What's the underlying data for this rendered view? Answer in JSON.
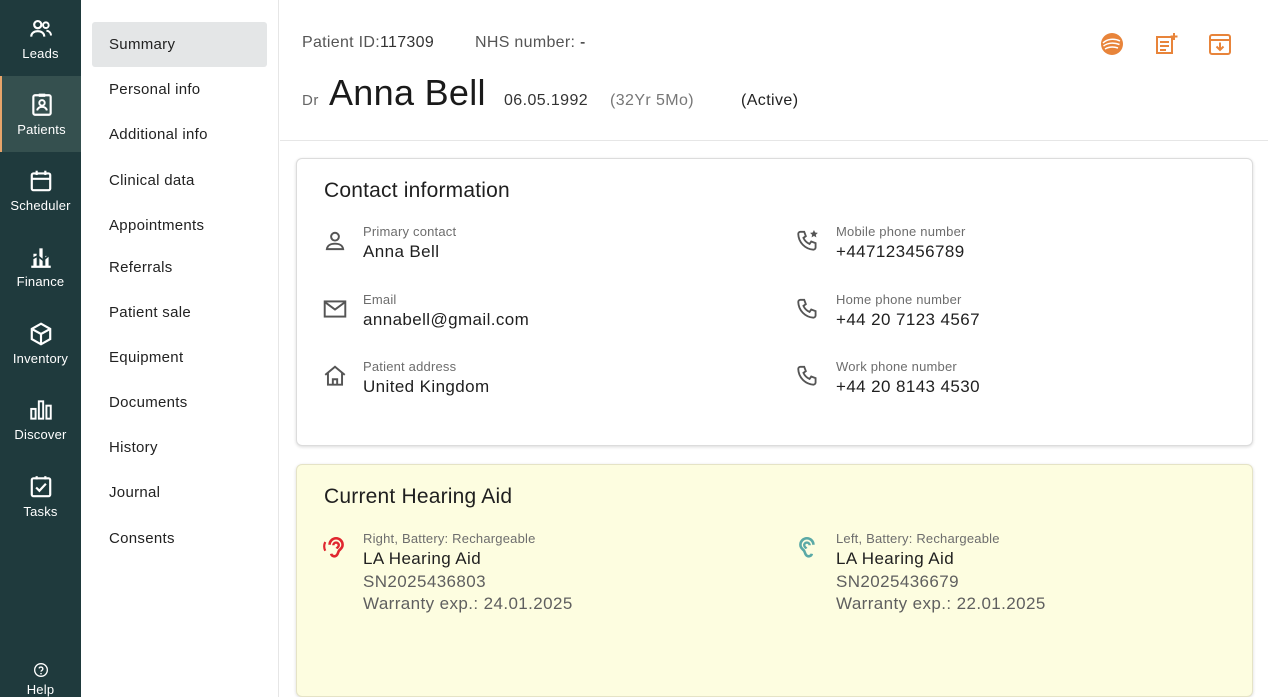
{
  "rail": {
    "items": [
      {
        "label": "Leads",
        "icon": "users-icon"
      },
      {
        "label": "Patients",
        "icon": "patient-badge-icon"
      },
      {
        "label": "Scheduler",
        "icon": "calendar-icon"
      },
      {
        "label": "Finance",
        "icon": "finance-chart-icon"
      },
      {
        "label": "Inventory",
        "icon": "box-icon"
      },
      {
        "label": "Discover",
        "icon": "bar-chart-icon"
      },
      {
        "label": "Tasks",
        "icon": "checkbox-icon"
      },
      {
        "label": "Help",
        "icon": "help-icon"
      }
    ],
    "active": "Patients"
  },
  "subnav": {
    "items": [
      "Summary",
      "Personal info",
      "Additional info",
      "Clinical data",
      "Appointments",
      "Referrals",
      "Patient sale",
      "Equipment",
      "Documents",
      "History",
      "Journal",
      "Consents"
    ],
    "active": "Summary"
  },
  "header": {
    "patient_id_label": "Patient ID:",
    "patient_id": "117309",
    "nhs_label": "NHS number:",
    "nhs_value": "-",
    "title": "Dr",
    "name": "Anna Bell",
    "dob": "06.05.1992",
    "age": "(32Yr 5Mo)",
    "status": "(Active)"
  },
  "contact": {
    "heading": "Contact information",
    "primary_label": "Primary contact",
    "primary_value": "Anna Bell",
    "email_label": "Email",
    "email_value": "annabell@gmail.com",
    "address_label": "Patient address",
    "address_value": "United Kingdom",
    "mobile_label": "Mobile phone number",
    "mobile_value": "+447123456789",
    "home_label": "Home phone number",
    "home_value": "+44 20 7123 4567",
    "work_label": "Work phone number",
    "work_value": "+44 20 8143 4530"
  },
  "hearing": {
    "heading": "Current Hearing Aid",
    "right": {
      "label": "Right, Battery: Rechargeable",
      "model": "LA Hearing Aid",
      "serial": "SN2025436803",
      "warranty": "Warranty exp.: 24.01.2025"
    },
    "left": {
      "label": "Left, Battery: Rechargeable",
      "model": "LA Hearing Aid",
      "serial": "SN2025436679",
      "warranty": "Warranty exp.: 22.01.2025"
    }
  },
  "colors": {
    "accent": "#e8843a",
    "rail_bg": "#1f3a3d",
    "right_ear": "#e0262f",
    "left_ear": "#5aa9a6",
    "hearing_bg": "#fdfde0"
  }
}
